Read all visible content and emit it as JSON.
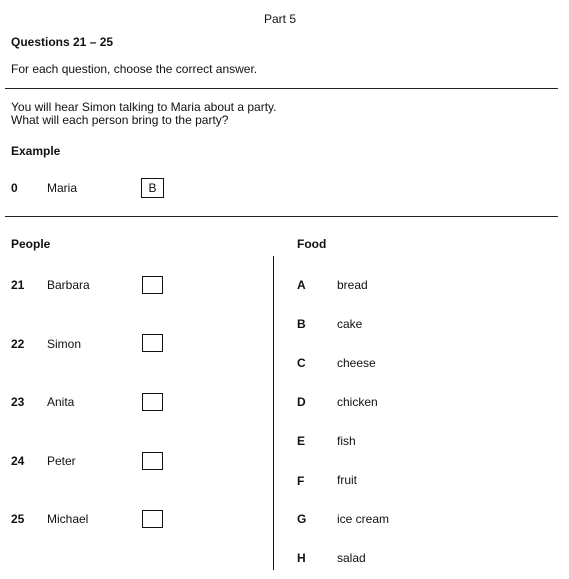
{
  "header": {
    "part": "Part 5",
    "questions": "Questions 21 – 25",
    "instruction": "For each question, choose the correct answer."
  },
  "intro": {
    "line1": "You will hear Simon talking to Maria about a party.",
    "line2": "What will each person bring to the party?"
  },
  "example": {
    "heading": "Example",
    "number": "0",
    "name": "Maria",
    "answer": "B"
  },
  "people": {
    "heading": "People",
    "items": [
      {
        "number": "21",
        "name": "Barbara",
        "answer": ""
      },
      {
        "number": "22",
        "name": "Simon",
        "answer": ""
      },
      {
        "number": "23",
        "name": "Anita",
        "answer": ""
      },
      {
        "number": "24",
        "name": "Peter",
        "answer": ""
      },
      {
        "number": "25",
        "name": "Michael",
        "answer": ""
      }
    ]
  },
  "food": {
    "heading": "Food",
    "items": [
      {
        "letter": "A",
        "name": "bread"
      },
      {
        "letter": "B",
        "name": "cake"
      },
      {
        "letter": "C",
        "name": "cheese"
      },
      {
        "letter": "D",
        "name": "chicken"
      },
      {
        "letter": "E",
        "name": "fish"
      },
      {
        "letter": "F",
        "name": "fruit"
      },
      {
        "letter": "G",
        "name": "ice cream"
      },
      {
        "letter": "H",
        "name": "salad"
      }
    ]
  }
}
